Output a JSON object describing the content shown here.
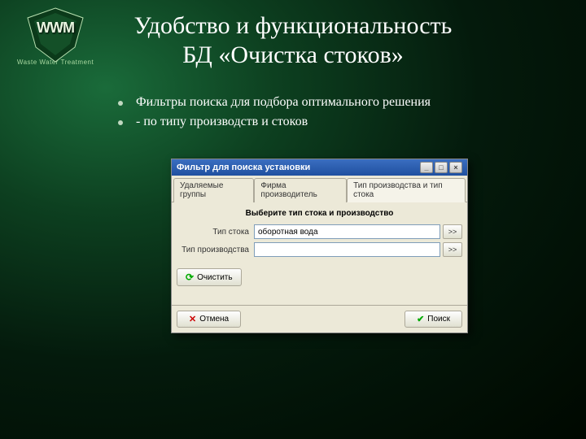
{
  "logo": {
    "main": "WWM",
    "sub": "Waste Water Treatment"
  },
  "title_line1": "Удобство и функциональность",
  "title_line2": "БД «Очистка стоков»",
  "bullets": [
    "Фильтры поиска для подбора оптимального решения",
    "- по типу производств и стоков"
  ],
  "dialog": {
    "title": "Фильтр для поиска установки",
    "tabs": [
      {
        "label": "Удаляемые группы"
      },
      {
        "label": "Фирма производитель"
      },
      {
        "label": "Тип производства и тип стока"
      }
    ],
    "instruction": "Выберите тип стока и производство",
    "fields": {
      "stock_label": "Тип стока",
      "stock_value": "оборотная вода",
      "prod_label": "Тип производства",
      "prod_value": ""
    },
    "expand": ">>",
    "clear": "Очистить",
    "cancel": "Отмена",
    "search": "Поиск"
  }
}
